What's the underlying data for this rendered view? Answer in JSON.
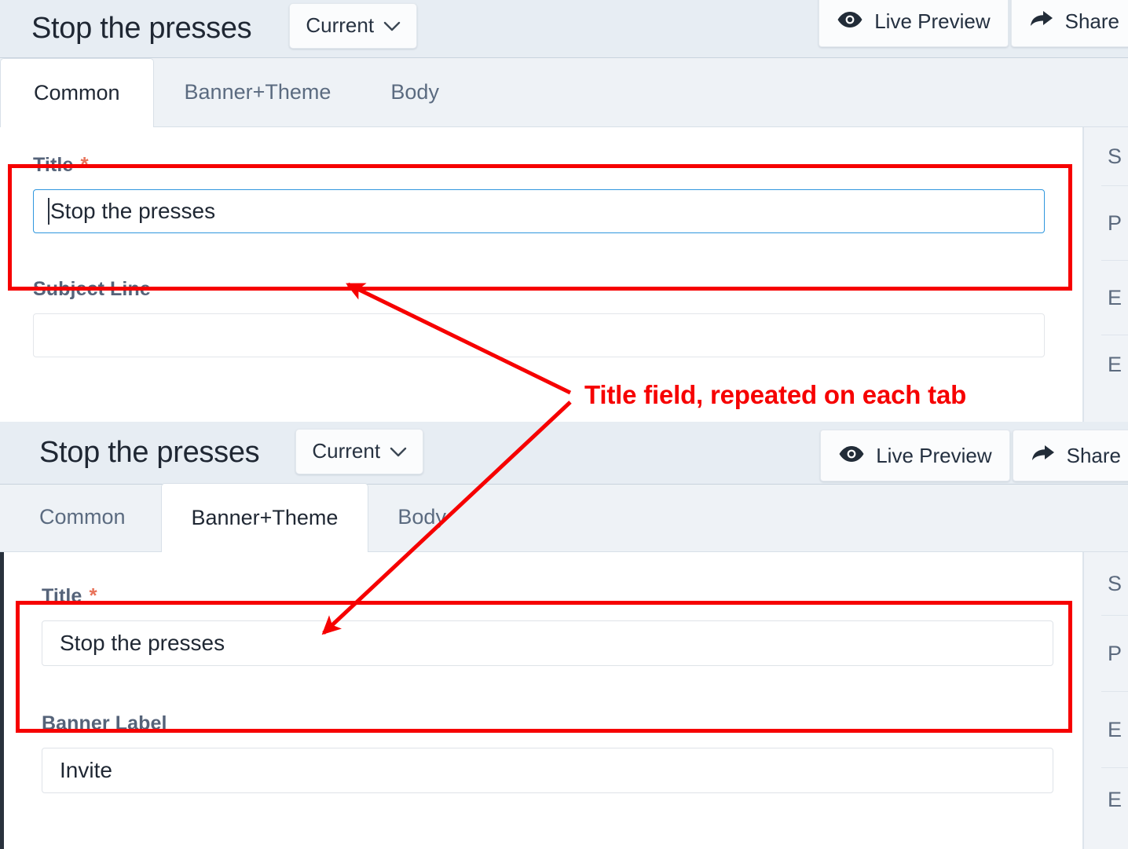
{
  "windows": [
    {
      "id": "window-common-tab",
      "header": {
        "title": "Stop the presses",
        "version_selector": {
          "label": "Current",
          "icon": "chevron-down-icon"
        },
        "actions": [
          {
            "label": "Live Preview",
            "icon": "eye-icon"
          },
          {
            "label": "Share",
            "icon": "share-arrow-icon"
          }
        ]
      },
      "tabs": [
        {
          "label": "Common",
          "active": true
        },
        {
          "label": "Banner+Theme",
          "active": false
        },
        {
          "label": "Body",
          "active": false
        }
      ],
      "fields": [
        {
          "label": "Title",
          "required": true,
          "required_marker": "*",
          "value": "Stop the presses",
          "focused": true,
          "placeholder": ""
        },
        {
          "label": "Subject Line",
          "required": false,
          "required_marker": "",
          "value": "",
          "focused": false,
          "placeholder": ""
        }
      ],
      "right_rail": [
        {
          "label": "S"
        },
        {
          "label": "P"
        },
        {
          "label": "E"
        },
        {
          "label": "E"
        }
      ]
    },
    {
      "id": "window-banner-theme-tab",
      "header": {
        "title": "Stop the presses",
        "version_selector": {
          "label": "Current",
          "icon": "chevron-down-icon"
        },
        "actions": [
          {
            "label": "Live Preview",
            "icon": "eye-icon"
          },
          {
            "label": "Share",
            "icon": "share-arrow-icon"
          }
        ]
      },
      "tabs": [
        {
          "label": "Common",
          "active": false
        },
        {
          "label": "Banner+Theme",
          "active": true
        },
        {
          "label": "Body",
          "active": false
        }
      ],
      "fields": [
        {
          "label": "Title",
          "required": true,
          "required_marker": "*",
          "value": "Stop the presses",
          "focused": false,
          "placeholder": ""
        },
        {
          "label": "Banner Label",
          "required": false,
          "required_marker": "",
          "value": "Invite",
          "focused": false,
          "placeholder": ""
        }
      ],
      "right_rail": [
        {
          "label": "S"
        },
        {
          "label": "P"
        },
        {
          "label": "E"
        },
        {
          "label": "E"
        }
      ]
    }
  ],
  "annotation": {
    "text": "Title field, repeated on each tab",
    "color": "#f60000"
  },
  "colors": {
    "header_bg": "#e7edf3",
    "tabstrip_bg": "#eef2f6",
    "accent_focus": "#2f97de",
    "required_star": "#e8735a",
    "annotation": "#f60000",
    "left_accent": "#29323d"
  }
}
